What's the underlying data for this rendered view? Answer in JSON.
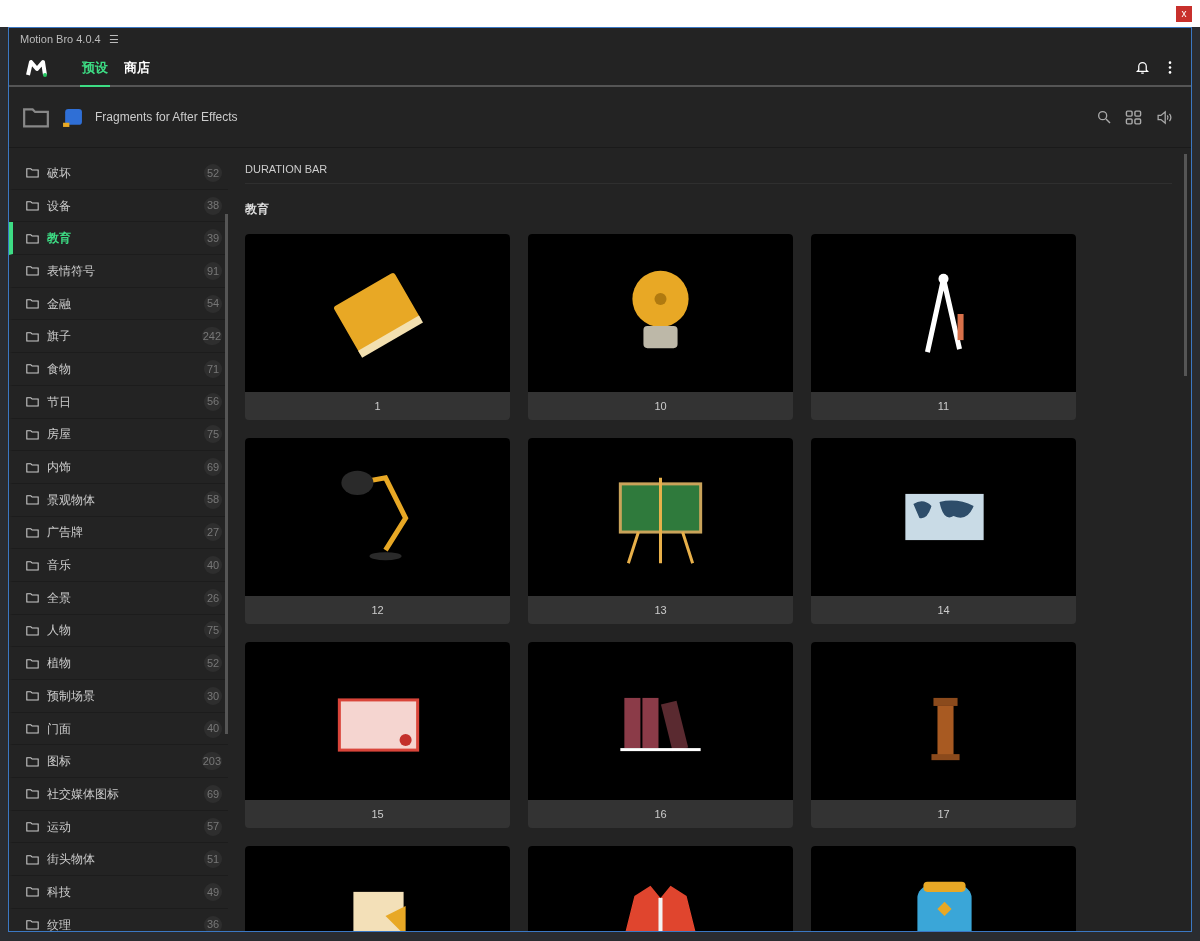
{
  "top_bar": {
    "close": "x"
  },
  "window": {
    "title": "Motion Bro 4.0.4",
    "menu": "☰"
  },
  "tabs": [
    {
      "label": "预设",
      "selected": true
    },
    {
      "label": "商店",
      "selected": false
    }
  ],
  "toolbar": {
    "title": "Fragments for After Effects"
  },
  "sidebar": {
    "items": [
      {
        "label": "破坏",
        "count": "52",
        "selected": false
      },
      {
        "label": "设备",
        "count": "38",
        "selected": false
      },
      {
        "label": "教育",
        "count": "39",
        "selected": true
      },
      {
        "label": "表情符号",
        "count": "91",
        "selected": false
      },
      {
        "label": "金融",
        "count": "54",
        "selected": false
      },
      {
        "label": "旗子",
        "count": "242",
        "selected": false
      },
      {
        "label": "食物",
        "count": "71",
        "selected": false
      },
      {
        "label": "节日",
        "count": "56",
        "selected": false
      },
      {
        "label": "房屋",
        "count": "75",
        "selected": false
      },
      {
        "label": "内饰",
        "count": "69",
        "selected": false
      },
      {
        "label": "景观物体",
        "count": "58",
        "selected": false
      },
      {
        "label": "广告牌",
        "count": "27",
        "selected": false
      },
      {
        "label": "音乐",
        "count": "40",
        "selected": false
      },
      {
        "label": "全景",
        "count": "26",
        "selected": false
      },
      {
        "label": "人物",
        "count": "75",
        "selected": false
      },
      {
        "label": "植物",
        "count": "52",
        "selected": false
      },
      {
        "label": "预制场景",
        "count": "30",
        "selected": false
      },
      {
        "label": "门面",
        "count": "40",
        "selected": false
      },
      {
        "label": "图标",
        "count": "203",
        "selected": false
      },
      {
        "label": "社交媒体图标",
        "count": "69",
        "selected": false
      },
      {
        "label": "运动",
        "count": "57",
        "selected": false
      },
      {
        "label": "街头物体",
        "count": "51",
        "selected": false
      },
      {
        "label": "科技",
        "count": "49",
        "selected": false
      },
      {
        "label": "纹理",
        "count": "36",
        "selected": false
      }
    ]
  },
  "content": {
    "section_bar": "DURATION BAR",
    "category": "教育",
    "cards": [
      {
        "label": "1",
        "kind": "book"
      },
      {
        "label": "10",
        "kind": "bell"
      },
      {
        "label": "11",
        "kind": "compass"
      },
      {
        "label": "12",
        "kind": "lamp"
      },
      {
        "label": "13",
        "kind": "board"
      },
      {
        "label": "14",
        "kind": "map"
      },
      {
        "label": "15",
        "kind": "diploma"
      },
      {
        "label": "16",
        "kind": "binders"
      },
      {
        "label": "17",
        "kind": "podium"
      },
      {
        "kind": "paper"
      },
      {
        "kind": "jacket"
      },
      {
        "kind": "backpack"
      }
    ]
  }
}
